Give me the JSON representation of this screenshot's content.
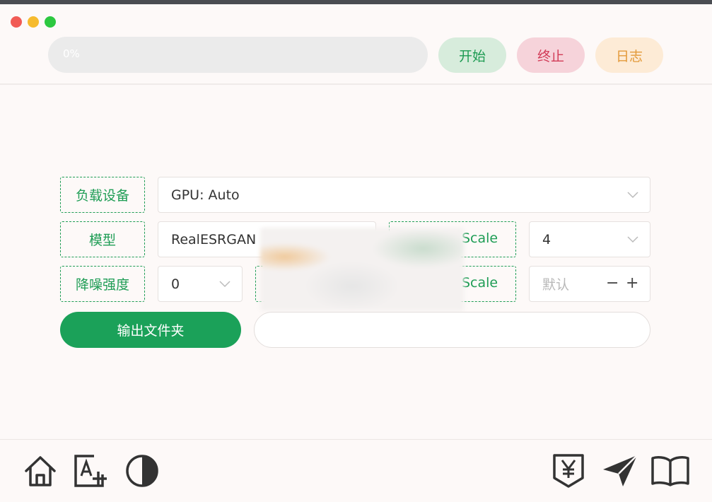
{
  "window": {
    "controls": [
      "close",
      "minimize",
      "zoom"
    ]
  },
  "progress": {
    "value": 0,
    "text": "0%"
  },
  "actions": {
    "start": "开始",
    "stop": "终止",
    "log": "日志"
  },
  "settings": {
    "device": {
      "label": "负载设备",
      "value": "GPU: Auto"
    },
    "model": {
      "label": "模型",
      "value": "RealESRGAN"
    },
    "scale": {
      "label_partial": "Scale",
      "value": "4"
    },
    "denoise": {
      "label": "降噪强度",
      "value": "0"
    },
    "custom_scale": {
      "label_partial": "Scale",
      "placeholder": "默认",
      "minus": "−",
      "plus": "+"
    },
    "output": {
      "button_label": "输出文件夹",
      "path_value": ""
    }
  },
  "bottom_nav": {
    "left_icons": [
      "home-icon",
      "text-image-add-icon",
      "contrast-icon"
    ],
    "right_icons": [
      "yen-tag-icon",
      "send-icon",
      "book-icon"
    ]
  },
  "colors": {
    "accent_green": "#1ba159",
    "stop_red": "#d23c58",
    "log_orange": "#e39a3a",
    "background": "#fdf9f8"
  }
}
